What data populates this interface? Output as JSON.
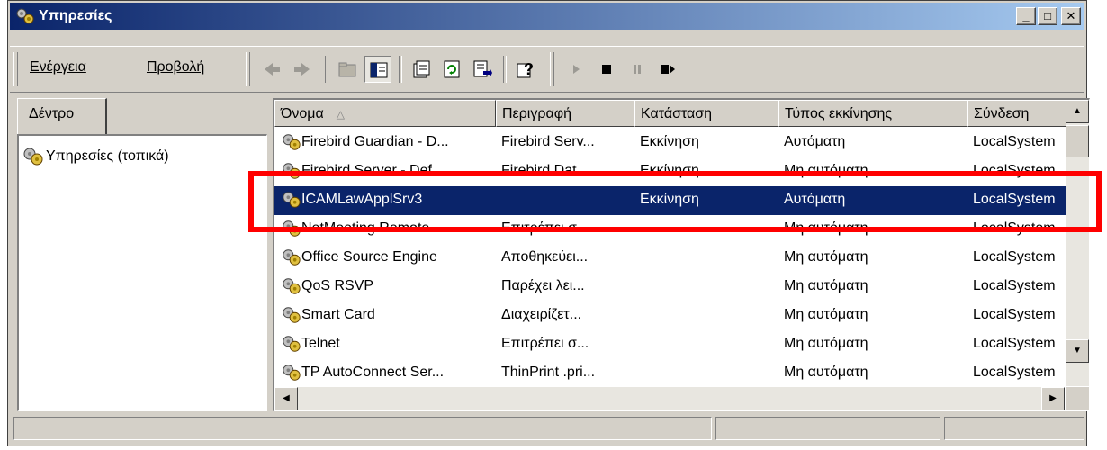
{
  "window": {
    "title": "Υπηρεσίες",
    "minimize_glyph": "_",
    "maximize_glyph": "□",
    "close_glyph": "✕"
  },
  "menu": {
    "action_label": "Ενέργεια",
    "view_label": "Προβολή"
  },
  "toolbar": {
    "icons": [
      "back-arrow-icon",
      "forward-arrow-icon",
      "up-folder-icon",
      "show-hide-tree-icon",
      "properties-icon",
      "refresh-icon",
      "export-list-icon",
      "help-icon",
      "start-service-icon",
      "stop-service-icon",
      "pause-service-icon",
      "restart-service-icon"
    ]
  },
  "tree": {
    "tab_label": "Δέντρο",
    "root_label": "Υπηρεσίες (τοπικά)"
  },
  "list": {
    "columns": [
      "Όνομα",
      "Περιγραφή",
      "Κατάσταση",
      "Τύπος εκκίνησης",
      "Σύνδεση"
    ],
    "sort_glyph": "△",
    "rows": [
      {
        "name": "Firebird Guardian - D...",
        "description": "Firebird Serv...",
        "status": "Εκκίνηση",
        "startup": "Αυτόματη",
        "logon": "LocalSystem"
      },
      {
        "name": "Firebird Server - Def...",
        "description": "Firebird Dat...",
        "status": "Εκκίνηση",
        "startup": "Μη αυτόματη",
        "logon": "LocalSystem"
      },
      {
        "name": "ICAMLawApplSrv3",
        "description": "",
        "status": "Εκκίνηση",
        "startup": "Αυτόματη",
        "logon": "LocalSystem"
      },
      {
        "name": "NetMeeting Remote ...",
        "description": "Επιτρέπει σ...",
        "status": "",
        "startup": "Μη αυτόματη",
        "logon": "LocalSystem"
      },
      {
        "name": "Office Source Engine",
        "description": "Αποθηκεύει...",
        "status": "",
        "startup": "Μη αυτόματη",
        "logon": "LocalSystem"
      },
      {
        "name": "QoS RSVP",
        "description": "Παρέχει λει...",
        "status": "",
        "startup": "Μη αυτόματη",
        "logon": "LocalSystem"
      },
      {
        "name": "Smart Card",
        "description": "Διαχειρίζετ...",
        "status": "",
        "startup": "Μη αυτόματη",
        "logon": "LocalSystem"
      },
      {
        "name": "Telnet",
        "description": "Επιτρέπει σ...",
        "status": "",
        "startup": "Μη αυτόματη",
        "logon": "LocalSystem"
      },
      {
        "name": "TP AutoConnect Ser...",
        "description": "ThinPrint .pri...",
        "status": "",
        "startup": "Μη αυτόματη",
        "logon": "LocalSystem"
      }
    ],
    "selected_row": "ICAMLawApplSrv3"
  },
  "colors": {
    "title_gradient_start": "#0a246a",
    "title_gradient_end": "#a6caf0",
    "selection": "#0a246a",
    "highlight_box": "#ff0000",
    "face": "#d4d0c8"
  }
}
